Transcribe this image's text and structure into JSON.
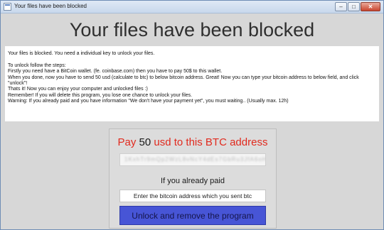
{
  "window": {
    "title": "Your files have been blocked",
    "controls": {
      "minimize_glyph": "–",
      "maximize_glyph": "□",
      "close_glyph": "✕"
    }
  },
  "headline": "Your files have been blocked",
  "info": {
    "line1": "Your files is blocked. You need a individual key to unlock your files.",
    "line2": "To unlock follow the steps:",
    "line3": "Firstly you need have a BitCoin wallet. (fe. coinbase.com) then you have to pay 50$ to this wallet.",
    "line4": "When you done, now you have to send 50 usd (calculate to btc) to below bitcoin address. Great! Now you can type your bitcoin address to below field, and click \"unlock\"!",
    "line5": "Thats it! Now you can enjoy your computer and unlocked files :)",
    "line6": "Remember! If you will delete this program, you lose one chance to unlock your files.",
    "line7": "Warning: If you already paid and you have information \"We don't have your payment yet\", you must waiting.. (Usually max. 12h)"
  },
  "payment": {
    "pay_prefix": "Pay ",
    "amount": "50",
    "pay_suffix": " usd to this BTC address",
    "btc_address_obscured": "1KxhTr9mQp2WzL8vNcY4dEs7GbRu3JfA6oH"
  },
  "paid_section": {
    "label": "If you already paid",
    "input_placeholder": "Enter the bitcoin address which you sent btc",
    "unlock_button": "Unlock and remove the program"
  },
  "colors": {
    "accent_red": "#e12a1e",
    "button_blue": "#4755d6",
    "window_bg": "#d7d7d7"
  }
}
